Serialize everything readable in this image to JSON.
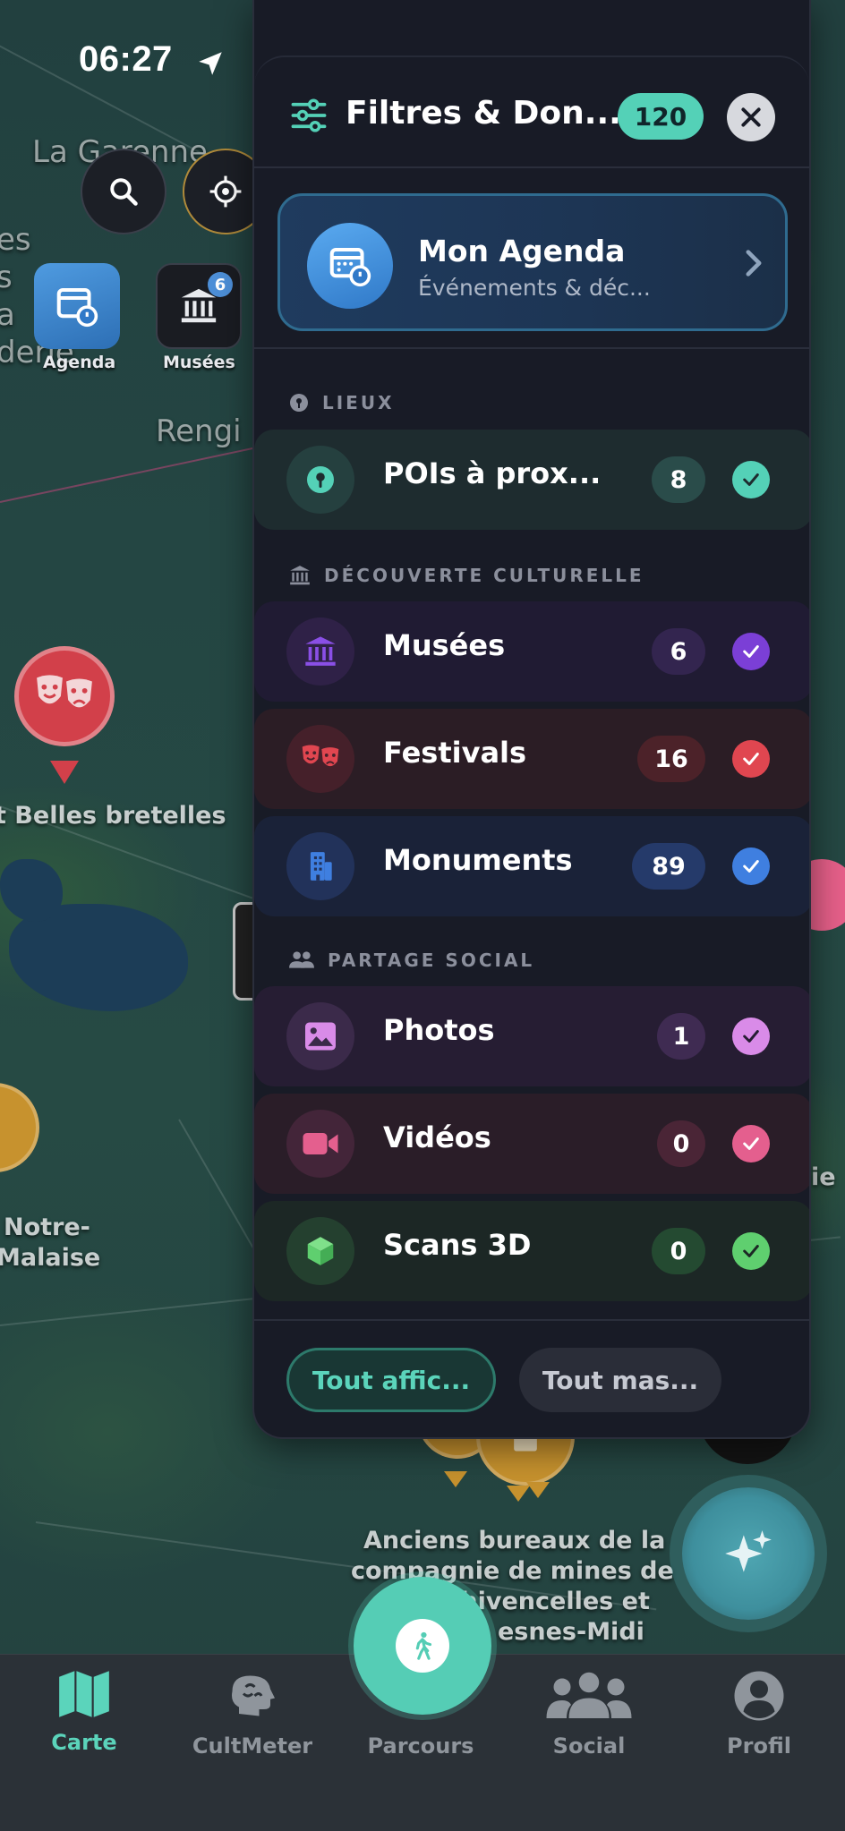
{
  "status_bar": {
    "time": "06:27"
  },
  "map": {
    "labels": {
      "la_garenne": "La Garenne",
      "es": "es",
      "s": "s",
      "a": "a",
      "derie": "derie",
      "rengi": "Rengi",
      "belles_bretelles": "t Belles bretelles",
      "notre": "Notre-",
      "malaise": "Malaise",
      "ie": "ie",
      "anciens_1": "Anciens bureaux de la",
      "anciens_2": "compagnie de mines de",
      "anciens_3": "Thivencelles et",
      "anciens_4": "esnes-Midi"
    },
    "quick_actions": [
      {
        "label": "Agenda",
        "icon": "calendar-clock-icon"
      },
      {
        "label": "Musées",
        "icon": "museum-icon",
        "badge": "6"
      }
    ]
  },
  "panel": {
    "title": "Filtres & Don...",
    "total_count": "120",
    "agenda": {
      "title": "Mon Agenda",
      "subtitle": "Événements & déc..."
    },
    "sections": [
      {
        "key": "lieux",
        "title": "LIEUX",
        "icon": "pin-icon",
        "rows": [
          {
            "label": "POIs à prox...",
            "count": "8",
            "checked": true,
            "icon": "map-pin-icon",
            "color": "#54d1b7"
          }
        ]
      },
      {
        "key": "culture",
        "title": "DÉCOUVERTE CULTURELLE",
        "icon": "museum-icon",
        "rows": [
          {
            "label": "Musées",
            "count": "6",
            "checked": true,
            "icon": "museum-icon",
            "color": "#7b3fd6"
          },
          {
            "label": "Festivals",
            "count": "16",
            "checked": true,
            "icon": "theater-masks-icon",
            "color": "#e04650"
          },
          {
            "label": "Monuments",
            "count": "89",
            "checked": true,
            "icon": "building-icon",
            "color": "#3f7fe0"
          }
        ]
      },
      {
        "key": "social",
        "title": "PARTAGE SOCIAL",
        "icon": "people-icon",
        "rows": [
          {
            "label": "Photos",
            "count": "1",
            "checked": true,
            "icon": "image-icon",
            "color": "#d98be8"
          },
          {
            "label": "Vidéos",
            "count": "0",
            "checked": true,
            "icon": "video-icon",
            "color": "#e45f8e"
          },
          {
            "label": "Scans 3D",
            "count": "0",
            "checked": true,
            "icon": "cube-icon",
            "color": "#5fcf6f"
          }
        ]
      }
    ],
    "footer": {
      "show_all": "Tout affic...",
      "hide_all": "Tout mas..."
    }
  },
  "tabbar": {
    "tabs": [
      {
        "label": "Carte",
        "icon": "map-icon",
        "active": true
      },
      {
        "label": "CultMeter",
        "icon": "brain-icon",
        "active": false
      },
      {
        "label": "Parcours",
        "icon": "walking-icon",
        "active": false
      },
      {
        "label": "Social",
        "icon": "group-icon",
        "active": false
      },
      {
        "label": "Profil",
        "icon": "user-icon",
        "active": false
      }
    ]
  },
  "colors": {
    "accent": "#54d1b7",
    "panel_bg": "#181b26"
  }
}
